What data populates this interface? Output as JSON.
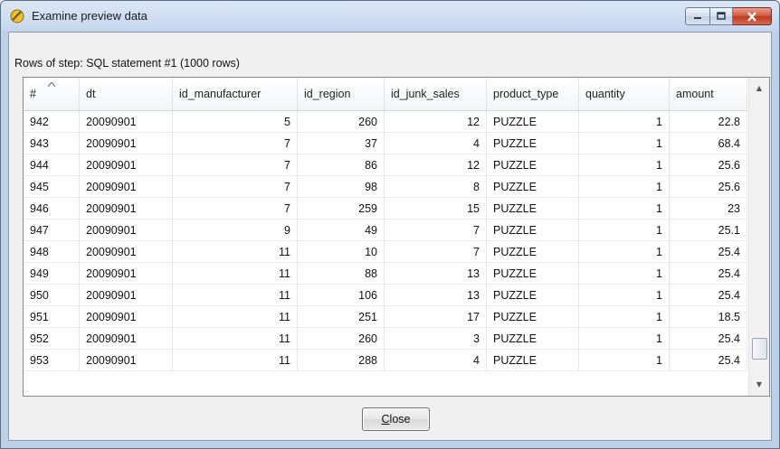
{
  "window": {
    "title": "Examine preview data",
    "controls": {
      "minimize": "—",
      "maximize": "▭",
      "close": "✕"
    }
  },
  "caption": "Rows of step: SQL statement #1 (1000 rows)",
  "table": {
    "columns": [
      "#",
      "dt",
      "id_manufacturer",
      "id_region",
      "id_junk_sales",
      "product_type",
      "quantity",
      "amount"
    ],
    "sort_indicator": "^",
    "rows": [
      [
        "942",
        "20090901",
        "5",
        "260",
        "12",
        "PUZZLE",
        "1",
        "22.8"
      ],
      [
        "943",
        "20090901",
        "7",
        "37",
        "4",
        "PUZZLE",
        "1",
        "68.4"
      ],
      [
        "944",
        "20090901",
        "7",
        "86",
        "12",
        "PUZZLE",
        "1",
        "25.6"
      ],
      [
        "945",
        "20090901",
        "7",
        "98",
        "8",
        "PUZZLE",
        "1",
        "25.6"
      ],
      [
        "946",
        "20090901",
        "7",
        "259",
        "15",
        "PUZZLE",
        "1",
        "23"
      ],
      [
        "947",
        "20090901",
        "9",
        "49",
        "7",
        "PUZZLE",
        "1",
        "25.1"
      ],
      [
        "948",
        "20090901",
        "11",
        "10",
        "7",
        "PUZZLE",
        "1",
        "25.4"
      ],
      [
        "949",
        "20090901",
        "11",
        "88",
        "13",
        "PUZZLE",
        "1",
        "25.4"
      ],
      [
        "950",
        "20090901",
        "11",
        "106",
        "13",
        "PUZZLE",
        "1",
        "25.4"
      ],
      [
        "951",
        "20090901",
        "11",
        "251",
        "17",
        "PUZZLE",
        "1",
        "18.5"
      ],
      [
        "952",
        "20090901",
        "11",
        "260",
        "3",
        "PUZZLE",
        "1",
        "25.4"
      ],
      [
        "953",
        "20090901",
        "11",
        "288",
        "4",
        "PUZZLE",
        "1",
        "25.4"
      ]
    ],
    "scroll": {
      "up": "▲",
      "down": "▼"
    }
  },
  "buttons": {
    "close_accel": "C",
    "close_rest": "lose"
  },
  "colors": {
    "title_gradient_top": "#dbe7f5",
    "close_button": "#c0381e"
  }
}
